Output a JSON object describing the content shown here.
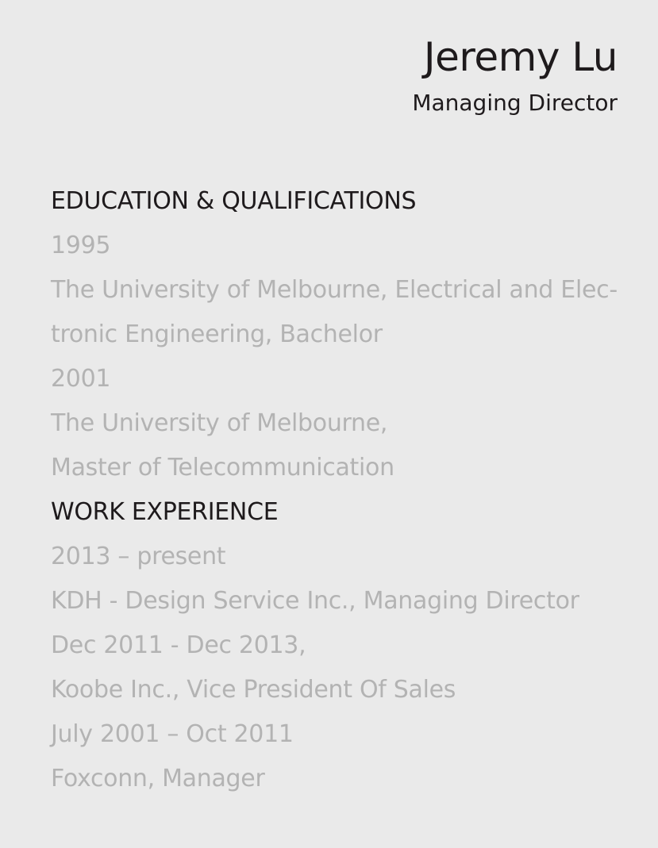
{
  "header": {
    "name": "Jeremy Lu",
    "title": "Managing Director"
  },
  "education": {
    "heading": "EDUCATION & QUALIFICATIONS",
    "lines": [
      "1995",
      "The University of Melbourne, Electrical and Elec-",
      "tronic Engineering, Bachelor",
      "2001",
      "The University of Melbourne,",
      "Master of Telecommunication"
    ]
  },
  "work": {
    "heading": "WORK EXPERIENCE",
    "lines": [
      "2013 – present",
      "KDH - Design Service Inc., Managing Director",
      "Dec 2011 - Dec 2013,",
      "Koobe Inc., Vice President Of Sales",
      "July 2001 – Oct 2011",
      "Foxconn, Manager"
    ]
  }
}
